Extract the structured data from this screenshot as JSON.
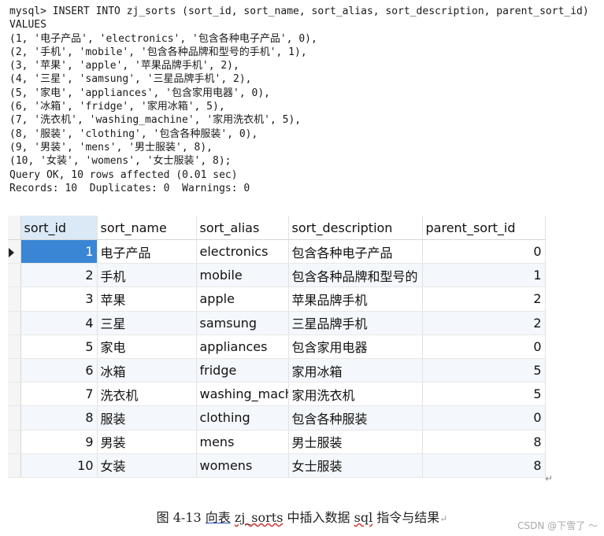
{
  "console": {
    "lines": [
      "mysql> INSERT INTO zj_sorts (sort_id, sort_name, sort_alias, sort_description, parent_sort_id)",
      "VALUES",
      "(1, '电子产品', 'electronics', '包含各种电子产品', 0),",
      "(2, '手机', 'mobile', '包含各种品牌和型号的手机', 1),",
      "(3, '苹果', 'apple', '苹果品牌手机', 2),",
      "(4, '三星', 'samsung', '三星品牌手机', 2),",
      "(5, '家电', 'appliances', '包含家用电器', 0),",
      "(6, '冰箱', 'fridge', '家用冰箱', 5),",
      "(7, '洗衣机', 'washing_machine', '家用洗衣机', 5),",
      "(8, '服装', 'clothing', '包含各种服装', 0),",
      "(9, '男装', 'mens', '男士服装', 8),",
      "(10, '女装', 'womens', '女士服装', 8);",
      "Query OK, 10 rows affected (0.01 sec)",
      "Records: 10  Duplicates: 0  Warnings: 0"
    ]
  },
  "grid": {
    "columns": [
      "sort_id",
      "sort_name",
      "sort_alias",
      "sort_description",
      "parent_sort_id"
    ],
    "rows": [
      [
        "1",
        "电子产品",
        "electronics",
        "包含各种电子产品",
        "0"
      ],
      [
        "2",
        "手机",
        "mobile",
        "包含各种品牌和型号的",
        "1"
      ],
      [
        "3",
        "苹果",
        "apple",
        "苹果品牌手机",
        "2"
      ],
      [
        "4",
        "三星",
        "samsung",
        "三星品牌手机",
        "2"
      ],
      [
        "5",
        "家电",
        "appliances",
        "包含家用电器",
        "0"
      ],
      [
        "6",
        "冰箱",
        "fridge",
        "家用冰箱",
        "5"
      ],
      [
        "7",
        "洗衣机",
        "washing_mach",
        "家用洗衣机",
        "5"
      ],
      [
        "8",
        "服装",
        "clothing",
        "包含各种服装",
        "0"
      ],
      [
        "9",
        "男装",
        "mens",
        "男士服装",
        "8"
      ],
      [
        "10",
        "女装",
        "womens",
        "女士服装",
        "8"
      ]
    ],
    "selected_column": "sort_id",
    "current_row": 1
  },
  "caption": {
    "prefix": "图 4-13 ",
    "u1": "向表",
    "space1": " ",
    "w1": "zj_sorts",
    "mid": " 中插入数据 ",
    "w2": "sql",
    "suffix": " 指令与结果",
    "mark": "↵"
  },
  "pilcrow": "↵",
  "watermark": "CSDN @下雪了 ～",
  "colors": {
    "selection": "#3a86d4",
    "header_selected": "#dbe9f7",
    "row_alt": "#f4f7fb"
  }
}
